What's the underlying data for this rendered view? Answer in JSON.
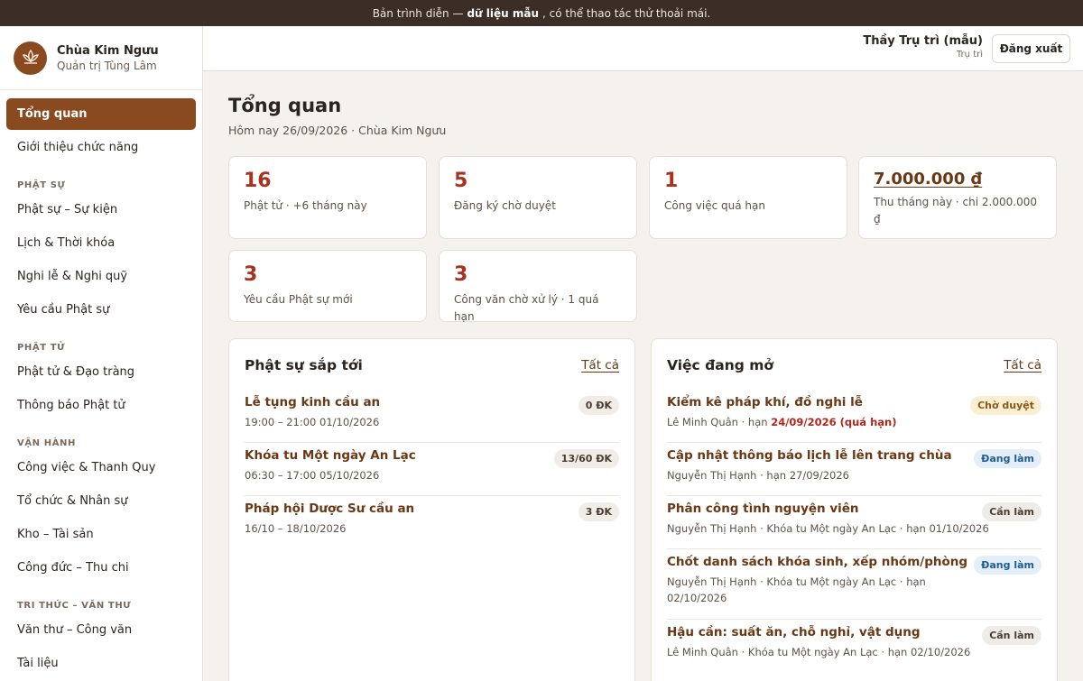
{
  "banner": {
    "before": "Bản trình diễn —",
    "bold": "dữ liệu mẫu",
    "after": ", có thể thao tác thử thoải mái."
  },
  "brand": {
    "name": "Chùa Kim Ngưu",
    "subtitle": "Quản trị Tùng Lâm",
    "icon": "lotus-icon"
  },
  "nav": {
    "overview": "Tổng quan",
    "intro": "Giới thiệu chức năng",
    "sec_phat_su": "PHẬT SỰ",
    "events": "Phật sự – Sự kiện",
    "schedule": "Lịch & Thời khóa",
    "rituals": "Nghi lễ & Nghi quỹ",
    "requests": "Yêu cầu Phật sự",
    "sec_phat_tu": "PHẬT TỬ",
    "members": "Phật tử & Đạo tràng",
    "notices": "Thông báo Phật tử",
    "sec_van_hanh": "VẬN HÀNH",
    "tasks": "Công việc & Thanh Quy",
    "org": "Tổ chức & Nhân sự",
    "inventory": "Kho – Tài sản",
    "finance": "Công đức – Thu chi",
    "sec_tri_thuc": "TRI THỨC – VĂN THƯ",
    "documents": "Văn thư – Công văn",
    "library": "Tài liệu"
  },
  "user": {
    "name": "Thầy Trụ trì (mẫu)",
    "role": "Trụ trì",
    "logout": "Đăng xuất"
  },
  "page": {
    "title": "Tổng quan",
    "subtitle": "Hôm nay 26/09/2026 · Chùa Kim Ngưu"
  },
  "stats": {
    "members": {
      "value": "16",
      "label": "Phật tử · +6 tháng này"
    },
    "pending": {
      "value": "5",
      "label": "Đăng ký chờ duyệt"
    },
    "overdue": {
      "value": "1",
      "label": "Công việc quá hạn"
    },
    "income": {
      "value": "7.000.000 ₫",
      "label": "Thu tháng này · chi 2.000.000 ₫"
    },
    "requests": {
      "value": "3",
      "label": "Yêu cầu Phật sự mới"
    },
    "docs": {
      "value": "3",
      "label": "Công văn chờ xử lý · 1 quá hạn"
    }
  },
  "events_panel": {
    "title": "Phật sự sắp tới",
    "link": "Tất cả",
    "items": [
      {
        "title": "Lễ tụng kinh cầu an",
        "time": "19:00 – 21:00 01/10/2026",
        "badge": "0 ĐK"
      },
      {
        "title": "Khóa tu Một ngày An Lạc",
        "time": "06:30 – 17:00 05/10/2026",
        "badge": "13/60 ĐK"
      },
      {
        "title": "Pháp hội Dược Sư cầu an",
        "time": "16/10 – 18/10/2026",
        "badge": "3 ĐK"
      }
    ]
  },
  "tasks_panel": {
    "title": "Việc đang mở",
    "link": "Tất cả",
    "items": [
      {
        "title": "Kiểm kê pháp khí, đồ nghi lễ",
        "meta": "Lê Minh Quân · hạn",
        "due": "24/09/2026 (quá hạn)",
        "status": "Chờ duyệt"
      },
      {
        "title": "Cập nhật thông báo lịch lễ lên trang chùa",
        "meta": "Nguyễn Thị Hạnh · hạn 27/09/2026",
        "status": "Đang làm"
      },
      {
        "title": "Phân công tình nguyện viên",
        "meta": "Nguyễn Thị Hạnh · Khóa tu Một ngày An Lạc · hạn 01/10/2026",
        "status": "Cần làm"
      },
      {
        "title": "Chốt danh sách khóa sinh, xếp nhóm/phòng",
        "meta": "Nguyễn Thị Hạnh · Khóa tu Một ngày An Lạc · hạn 02/10/2026",
        "status": "Đang làm"
      },
      {
        "title": "Hậu cần: suất ăn, chỗ nghỉ, vật dụng",
        "meta": "Lê Minh Quân · Khóa tu Một ngày An Lạc · hạn 02/10/2026",
        "status": "Cần làm"
      }
    ]
  },
  "colors": {
    "accent": "#8a4a1f",
    "danger": "#a8321f",
    "banner": "#3a2e26"
  }
}
